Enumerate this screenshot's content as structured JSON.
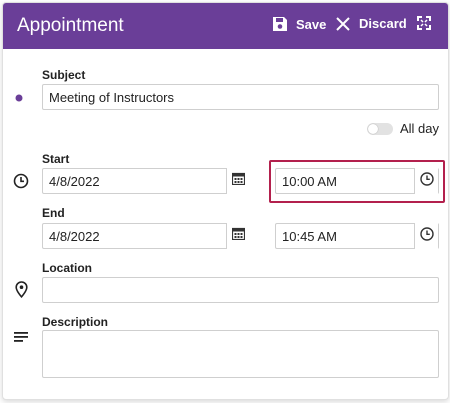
{
  "header": {
    "title": "Appointment",
    "save_label": "Save",
    "discard_label": "Discard"
  },
  "subject": {
    "label": "Subject",
    "value": "Meeting of Instructors"
  },
  "all_day": {
    "label": "All day",
    "checked": false
  },
  "start": {
    "label": "Start",
    "date": "4/8/2022",
    "time": "10:00 AM"
  },
  "end": {
    "label": "End",
    "date": "4/8/2022",
    "time": "10:45 AM"
  },
  "location": {
    "label": "Location",
    "value": ""
  },
  "description": {
    "label": "Description",
    "value": ""
  },
  "colors": {
    "header_bg": "#6a3e98",
    "accent": "#6a3e98",
    "focus": "#b3204d"
  },
  "icons": [
    "save-icon",
    "close-icon",
    "maximize-icon",
    "calendar-icon",
    "clock-icon",
    "location-pin-icon",
    "description-lines-icon",
    "dot-icon"
  ]
}
